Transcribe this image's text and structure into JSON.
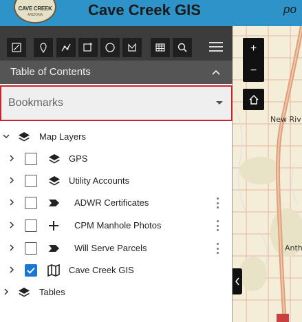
{
  "header": {
    "title": "Cave Creek GIS",
    "right_text": "po",
    "logo_text": "CAVE CREEK",
    "logo_sub": "ARIZONA",
    "color": "#2d93c9"
  },
  "toolbar": {
    "tools": [
      "measure-icon",
      "marker-icon",
      "polyline-icon",
      "add-note-icon",
      "circle-icon",
      "polygon-icon",
      "table-icon",
      "search-icon"
    ],
    "menu_icon": "hamburger-menu-icon"
  },
  "toc": {
    "title": "Table of Contents",
    "collapse_icon": "chevron-up-icon"
  },
  "bookmarks": {
    "value": "Bookmarks",
    "accent": "#d0202b"
  },
  "layers": [
    {
      "label": "Map Layers",
      "icon": "layers-icon",
      "expanded": true,
      "checkbox": false,
      "level": 0
    },
    {
      "label": "GPS",
      "icon": "layers-icon",
      "expanded": false,
      "checkbox": true,
      "checked": false,
      "level": 1
    },
    {
      "label": "Utility Accounts",
      "icon": "layers-icon",
      "expanded": false,
      "checkbox": true,
      "checked": false,
      "level": 1
    },
    {
      "label": "ADWR Certificates",
      "icon": "polygon-symbol-icon",
      "expanded": false,
      "checkbox": true,
      "checked": false,
      "level": 1,
      "menu": true
    },
    {
      "label": "CPM Manhole Photos",
      "icon": "cross-symbol-icon",
      "expanded": false,
      "checkbox": true,
      "checked": false,
      "level": 1,
      "menu": true
    },
    {
      "label": "Will Serve Parcels",
      "icon": "polygon-symbol-icon",
      "expanded": false,
      "checkbox": true,
      "checked": false,
      "level": 1,
      "menu": true
    },
    {
      "label": "Cave Creek GIS",
      "icon": "map-icon",
      "expanded": false,
      "checkbox": true,
      "checked": true,
      "level": 1
    },
    {
      "label": "Tables",
      "icon": "layers-icon",
      "expanded": false,
      "checkbox": false,
      "level": 0
    }
  ],
  "map": {
    "labels": [
      "New Riv",
      "Anth"
    ],
    "zoom_in": "+",
    "zoom_out": "−",
    "home_icon": "home-icon",
    "collapse_icon": "chevron-left-icon"
  }
}
